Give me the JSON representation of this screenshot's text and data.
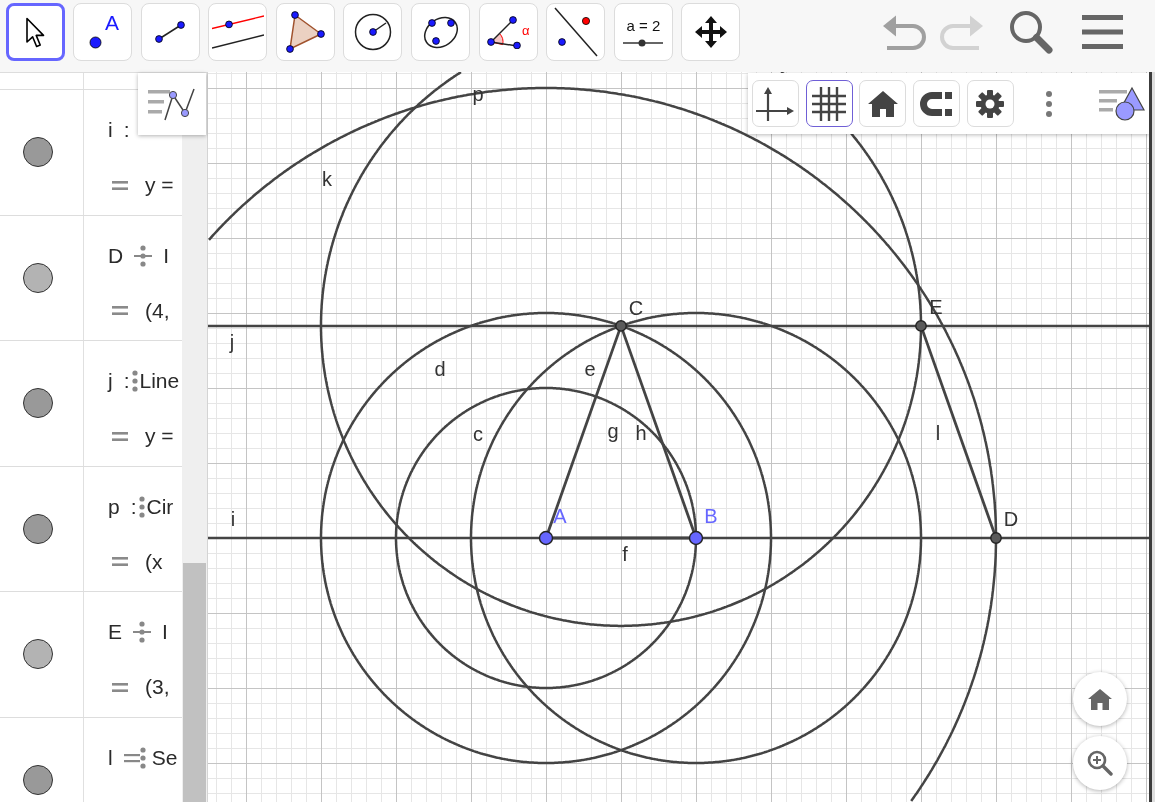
{
  "toolbar": {
    "tools": [
      {
        "kind": "move",
        "selected": true
      },
      {
        "kind": "point",
        "selected": false,
        "caption": "A"
      },
      {
        "kind": "segment",
        "selected": false
      },
      {
        "kind": "parallel",
        "selected": false
      },
      {
        "kind": "polygon",
        "selected": false
      },
      {
        "kind": "circle",
        "selected": false
      },
      {
        "kind": "conic",
        "selected": false
      },
      {
        "kind": "angle",
        "selected": false,
        "caption": "α"
      },
      {
        "kind": "reflect",
        "selected": false
      },
      {
        "kind": "slider",
        "selected": false,
        "caption": "a = 2"
      },
      {
        "kind": "pan",
        "selected": false
      }
    ],
    "undo": {
      "disabled": false
    },
    "redo": {
      "disabled": true
    }
  },
  "algebra": {
    "rows": [
      {
        "label": "i",
        "kind": "colon",
        "separator": ":",
        "handle": false,
        "color": "#999999",
        "value": "y ="
      },
      {
        "label": "D",
        "kind": "divide",
        "handle": false,
        "definition": "I",
        "color": "#b3b3b3",
        "value": "(4,"
      },
      {
        "label": "j",
        "kind": "colon",
        "separator": ":",
        "handle": true,
        "definition": "Line",
        "color": "#999999",
        "value": "y ="
      },
      {
        "label": "p",
        "kind": "colon",
        "separator": ":",
        "handle": true,
        "definition": "Cir",
        "color": "#999999",
        "value": "(x"
      },
      {
        "label": "E",
        "kind": "divide",
        "handle": false,
        "definition": "I",
        "color": "#b3b3b3",
        "value": "(3,"
      },
      {
        "label": "l",
        "kind": "equals",
        "handle": false,
        "definition": "Se",
        "color": "#999999"
      }
    ]
  },
  "graphics": {
    "style_bar": [
      {
        "kind": "axes",
        "selected": false
      },
      {
        "kind": "grid",
        "selected": true
      },
      {
        "kind": "home",
        "selected": false
      },
      {
        "kind": "magnet",
        "selected": false
      },
      {
        "kind": "settings",
        "selected": false
      },
      {
        "kind": "more",
        "selected": false
      },
      {
        "kind": "view-toggle",
        "selected": false
      }
    ],
    "objects": [
      {
        "label": "p",
        "kind": "circle"
      },
      {
        "label": "k",
        "kind": "circle"
      },
      {
        "label": "j",
        "kind": "line"
      },
      {
        "label": "d",
        "kind": "circle"
      },
      {
        "label": "e",
        "kind": "circle"
      },
      {
        "label": "c",
        "kind": "circle"
      },
      {
        "label": "g",
        "kind": "segment"
      },
      {
        "label": "h",
        "kind": "segment"
      },
      {
        "label": "i",
        "kind": "line"
      },
      {
        "label": "f",
        "kind": "segment"
      },
      {
        "label": "l",
        "kind": "segment"
      }
    ],
    "points": [
      {
        "label": "A",
        "kind": "free"
      },
      {
        "label": "B",
        "kind": "free"
      },
      {
        "label": "C",
        "kind": "dependent"
      },
      {
        "label": "D",
        "kind": "dependent"
      },
      {
        "label": "E",
        "kind": "dependent"
      }
    ],
    "view_buttons": [
      {
        "kind": "home"
      },
      {
        "kind": "zoom-in"
      }
    ]
  }
}
